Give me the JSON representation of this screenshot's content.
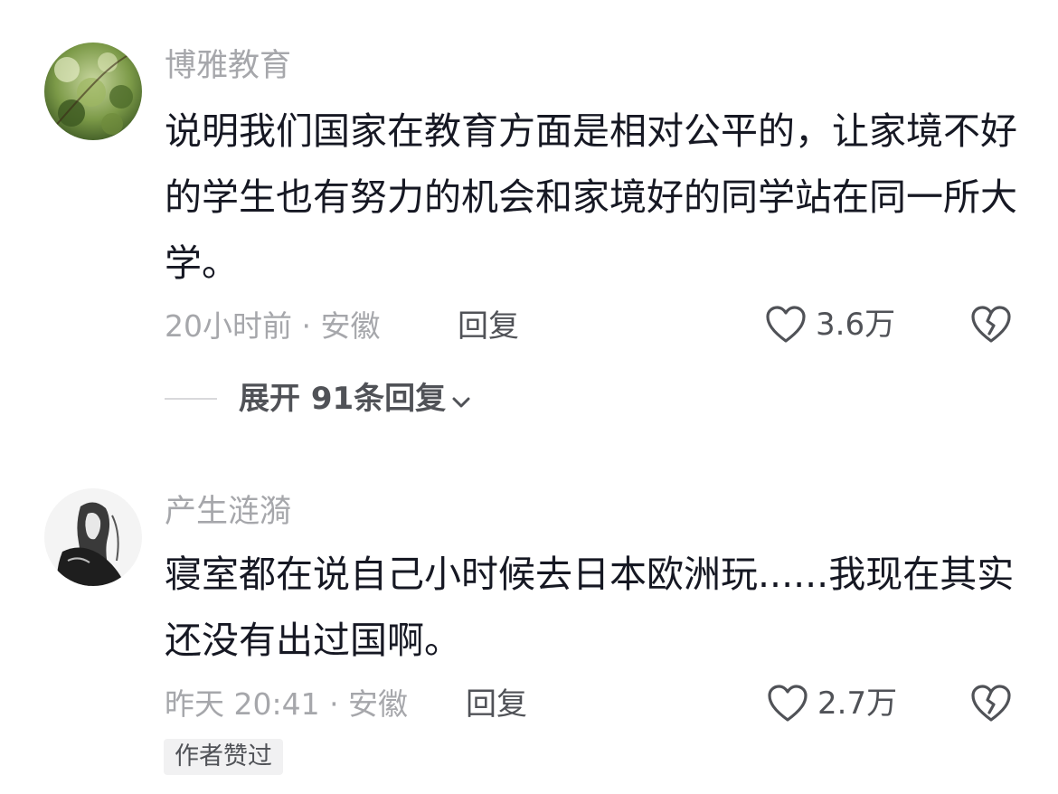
{
  "comments": [
    {
      "username": "博雅教育",
      "content": "说明我们国家在教育方面是相对公平的，让家境不好的学生也有努力的机会和家境好的同学站在同一所大学。",
      "meta": "20小时前 · 安徽",
      "reply_label": "回复",
      "like_count": "3.6万",
      "expand_label": "展开 91条回复",
      "icons": {
        "like": "heart-outline-icon",
        "dislike": "broken-heart-icon",
        "expand": "chevron-down-icon"
      }
    },
    {
      "username": "产生涟漪",
      "content": "寝室都在说自己小时候去日本欧洲玩......我现在其实还没有出过国啊。",
      "meta": "昨天 20:41 · 安徽",
      "reply_label": "回复",
      "like_count": "2.7万",
      "badge": "作者赞过",
      "icons": {
        "like": "heart-outline-icon",
        "dislike": "broken-heart-icon"
      }
    }
  ],
  "colors": {
    "primary_text": "#161823",
    "secondary_text": "#a6a7ab",
    "action_text": "#505257",
    "badge_bg": "#f1f1f2"
  }
}
